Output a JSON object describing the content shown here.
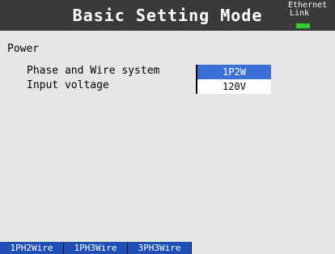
{
  "header": {
    "title": "Basic Setting Mode",
    "status_line1": "Ethernet",
    "status_line2": "Link",
    "link_led_color": "#33cc33"
  },
  "section": {
    "title": "Power"
  },
  "settings": [
    {
      "label": "Phase and Wire system",
      "value": "1P2W",
      "selected": true
    },
    {
      "label": "Input voltage",
      "value": "120V",
      "selected": false
    }
  ],
  "softkeys": [
    "1PH2Wire",
    "1PH3Wire",
    "3PH3Wire"
  ],
  "colors": {
    "titlebar": "#3a3a3a",
    "selection": "#3a6fd8",
    "softkey": "#1f4fb5",
    "background": "#e6e6e6"
  }
}
